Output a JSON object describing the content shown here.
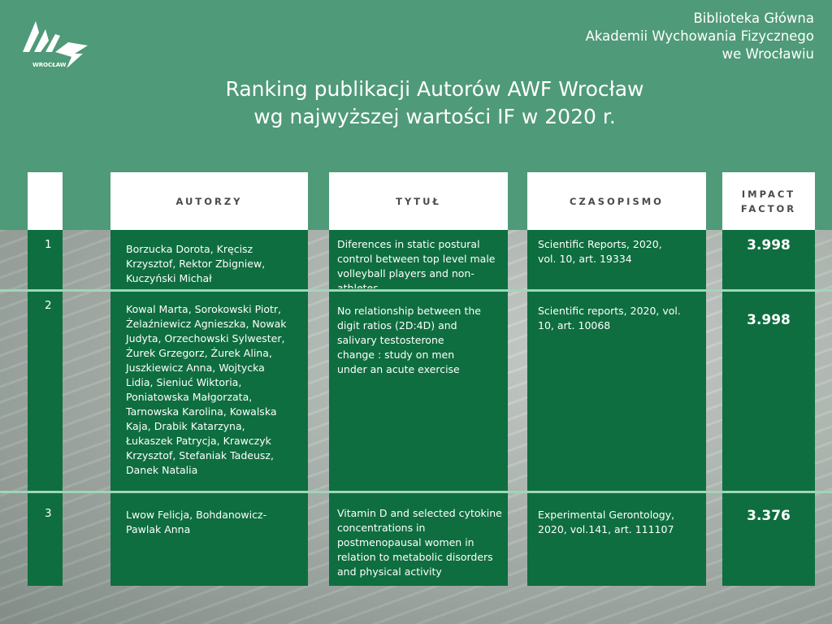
{
  "library": {
    "line1": "Biblioteka Główna",
    "line2": "Akademii Wychowania Fizycznego",
    "line3": "we Wrocławiu"
  },
  "logo": {
    "icon": "awf-logo-icon",
    "text": "WROCŁAW"
  },
  "title": {
    "line1": "Ranking publikacji Autorów AWF Wrocław",
    "line2": "wg najwyższej wartości IF w 2020 r."
  },
  "headers": {
    "authors": "AUTORZY",
    "title": "TYTUŁ",
    "journal": "CZASOPISMO",
    "if_line1": "IMPACT",
    "if_line2": "FACTOR"
  },
  "rows": [
    {
      "num": "1",
      "authors": "Borzucka Dorota, Kręcisz Krzysztof, Rektor Zbigniew, Kuczyński Michał",
      "title": "Diferences in static postural control between top level male volleyball players and non-athletes",
      "journal": "Scientific Reports, 2020, vol. 10, art. 19334",
      "if": "3.998"
    },
    {
      "num": "2",
      "authors": "Kowal Marta, Sorokowski Piotr, Żelaźniewicz Agnieszka, Nowak Judyta, Orzechowski Sylwester, Żurek Grzegorz, Żurek Alina, Juszkiewicz Anna, Wojtycka Lidia, Sieniuć Wiktoria, Poniatowska Małgorzata, Tarnowska Karolina, Kowalska Kaja, Drabik Katarzyna, Łukaszek Patrycja, Krawczyk Krzysztof, Stefaniak Tadeusz, Danek Natalia",
      "title": "No relationship between the digit ratios (2D:4D) and salivary testosterone change : study on men under an acute exercise",
      "journal": "Scientific reports, 2020, vol. 10, art. 10068",
      "if": "3.998"
    },
    {
      "num": "3",
      "authors": "Lwow Felicja, Bohdanowicz-Pawlak Anna",
      "title": "Vitamin D and selected cytokine concentrations in postmenopausal women in relation to metabolic disorders and physical activity",
      "journal": "Experimental Gerontology, 2020, vol.141, art. 111107",
      "if": "3.376"
    }
  ],
  "colors": {
    "band": "#4f9a78",
    "column": "#0e6e3f",
    "header_bg": "#ffffff",
    "divider": "#9fd6b8"
  }
}
